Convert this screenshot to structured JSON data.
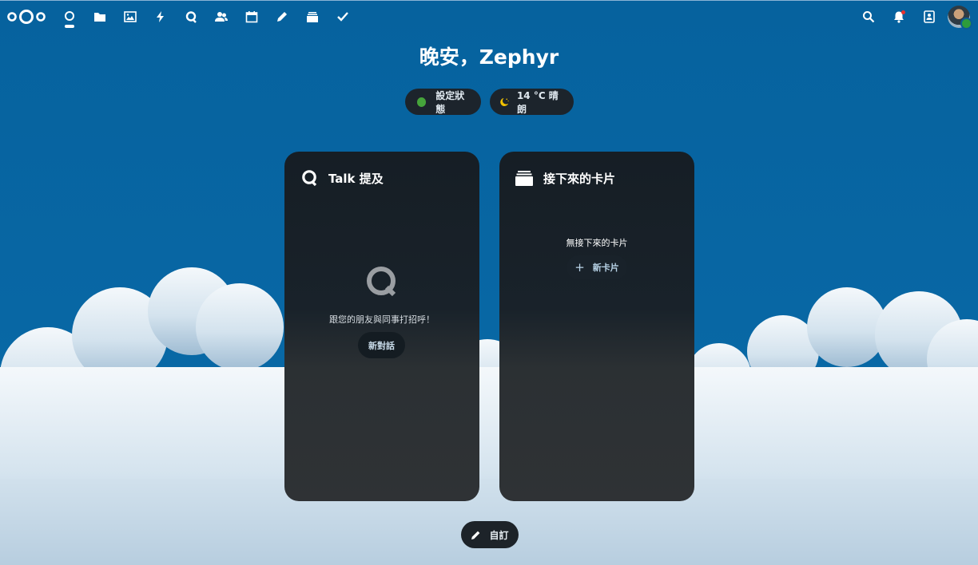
{
  "colors": {
    "primary": "#0765a3",
    "status_online": "#45a43b",
    "notification": "#e9322d"
  },
  "topbar": {
    "logo_icon": "nextcloud-logo",
    "nav_icons": [
      "dashboard-icon",
      "files-icon",
      "photos-icon",
      "activity-icon",
      "talk-icon",
      "contacts-icon",
      "calendar-icon",
      "notes-icon",
      "deck-icon",
      "tasks-icon"
    ],
    "active_app": "dashboard",
    "right_icons": [
      "search-icon",
      "notifications-icon",
      "contacts-menu-icon",
      "user-avatar"
    ]
  },
  "greeting": "晚安，Zephyr",
  "status": {
    "label": "設定狀態",
    "icon": "online-status-dot"
  },
  "weather": {
    "label": "14 °C 晴朗",
    "icon": "moon-stars-icon"
  },
  "widgets": {
    "talk": {
      "title": "Talk 提及",
      "icon": "talk-icon",
      "empty_text": "跟您的朋友與同事打招呼！",
      "button": "新對話"
    },
    "deck": {
      "title": "接下來的卡片",
      "icon": "deck-icon",
      "empty_text": "無接下來的卡片",
      "button_icon": "+",
      "button": "新卡片"
    }
  },
  "customize": {
    "label": "自訂",
    "icon": "pencil-icon"
  }
}
